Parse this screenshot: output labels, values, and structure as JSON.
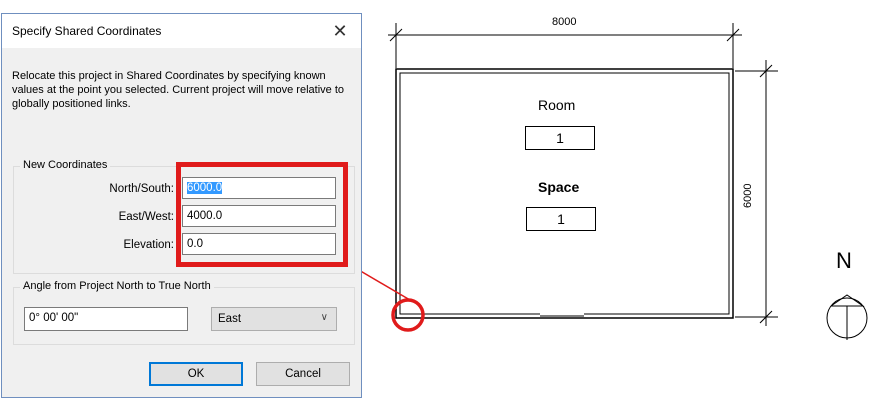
{
  "dialog": {
    "title": "Specify Shared Coordinates",
    "close_glyph": "✕",
    "description": "Relocate this project in Shared Coordinates by specifying known values at the point you selected. Current project will move relative to globally positioned links.",
    "new_coordinates": {
      "group_label": "New Coordinates",
      "north_south_label": "North/South:",
      "north_south_value": "6000.0",
      "east_west_label": "East/West:",
      "east_west_value": "4000.0",
      "elevation_label": "Elevation:",
      "elevation_value": "0.0"
    },
    "angle": {
      "group_label": "Angle from Project North to True North",
      "angle_value": "0° 00' 00\"",
      "direction_value": "East"
    },
    "ok_label": "OK",
    "cancel_label": "Cancel"
  },
  "plan": {
    "width_dimension": "8000",
    "height_dimension": "6000",
    "room_label": "Room",
    "room_number": "1",
    "space_label": "Space",
    "space_number": "1",
    "north_label": "N"
  },
  "colors": {
    "highlight": "#e01b1b",
    "selection": "#3399ff"
  }
}
